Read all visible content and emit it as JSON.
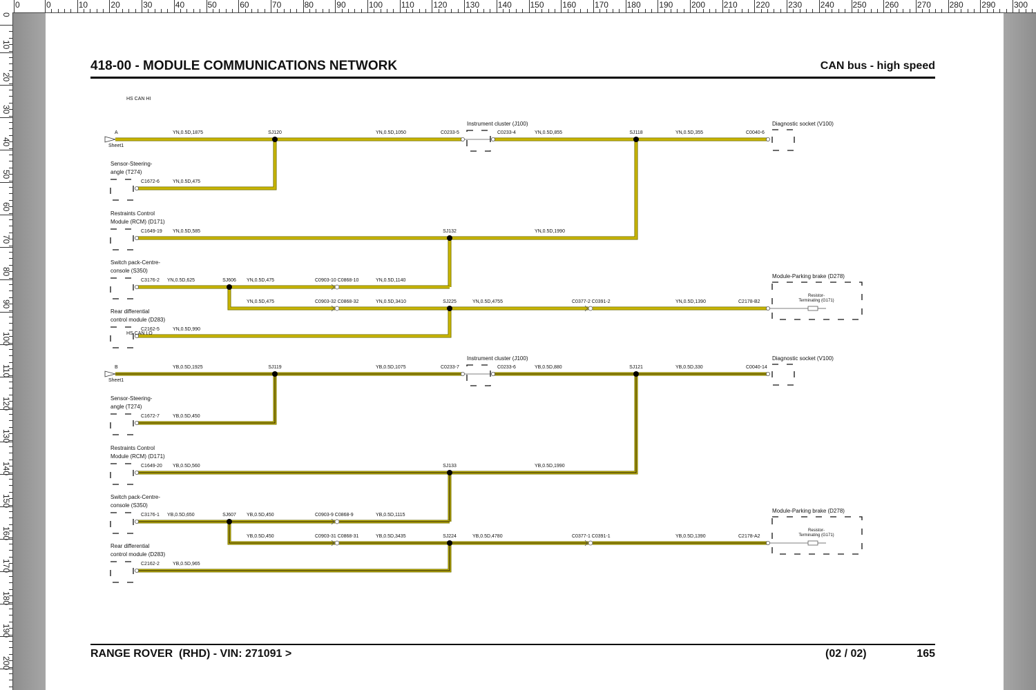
{
  "ruler": {
    "top_labels": [
      "0",
      "0",
      "10",
      "20",
      "30",
      "40",
      "50",
      "60",
      "70",
      "80",
      "90",
      "100",
      "110",
      "120",
      "130",
      "140",
      "150",
      "160",
      "170",
      "180",
      "190",
      "200",
      "210",
      "220",
      "230",
      "240",
      "250",
      "260",
      "270",
      "280",
      "290",
      "300"
    ],
    "left_labels": [
      "0",
      "10",
      "20",
      "30",
      "40",
      "50",
      "60",
      "70",
      "80",
      "90",
      "100",
      "110",
      "120",
      "130",
      "140",
      "150",
      "160",
      "170",
      "180",
      "190",
      "200"
    ]
  },
  "header": {
    "title": "418-00 - MODULE COMMUNICATIONS NETWORK",
    "subtitle": "CAN bus - high speed"
  },
  "footer": {
    "vehicle": "RANGE ROVER  (RHD) - VIN: 271091 >",
    "page_of": "(02 / 02)",
    "page_number": "165"
  },
  "colors": {
    "hi_wire": "#c8b400",
    "lo_wire": "#c8b400",
    "lo_core": "#1a1a1a",
    "outline": "#6b6b00"
  },
  "diagram": {
    "hi": {
      "net_label": "HS CAN HI",
      "offpage_letter": "A",
      "offpage_sheet": "Sheet1",
      "cluster_name": "Instrument cluster (J100)",
      "diag_name": "Diagnostic socket (V100)",
      "park_name": "Module-Parking brake (D278)",
      "resistor_label1": "Resistor-",
      "resistor_label2": "Terminating (G171)",
      "ssa_name1": "Sensor-Steering-",
      "ssa_name2": "angle (T274)",
      "rcm_name1": "Restraints Control",
      "rcm_name2": "Module (RCM) (D171)",
      "sw_name1": "Switch pack-Centre-",
      "sw_name2": "console (S350)",
      "rd_name1": "Rear differential",
      "rd_name2": "control module (D283)",
      "splices": [
        "SJ120",
        "SJ118",
        "SJ132",
        "SJ606",
        "SJ225"
      ],
      "connectors": [
        "C0233-5",
        "C0233-4",
        "C0040-6",
        "C1672-6",
        "C1649-19",
        "C3176-2",
        "C0903-10 C0868-10",
        "C0903-32 C0868-32",
        "C0377-2 C0391-2",
        "C2178-B2",
        "C2162-5"
      ],
      "wires": [
        "YN,0.5D,1875",
        "YN,0.5D,1050",
        "YN,0.5D,855",
        "YN,0.5D,355",
        "YN,0.5D,475",
        "YN,0.5D,585",
        "YN,0.5D,1990",
        "YN,0.5D,625",
        "YN,0.5D,475",
        "YN,0.5D,1140",
        "YN,0.5D,475",
        "YN,0.5D,3410",
        "YN,0.5D,4755",
        "YN,0.5D,1390",
        "YN,0.5D,990"
      ]
    },
    "lo": {
      "net_label": "HS CAN LO",
      "offpage_letter": "B",
      "offpage_sheet": "Sheet1",
      "cluster_name": "Instrument cluster (J100)",
      "diag_name": "Diagnostic socket (V100)",
      "park_name": "Module-Parking brake (D278)",
      "resistor_label1": "Resistor-",
      "resistor_label2": "Terminating (G171)",
      "ssa_name1": "Sensor-Steering-",
      "ssa_name2": "angle (T274)",
      "rcm_name1": "Restraints Control",
      "rcm_name2": "Module (RCM) (D171)",
      "sw_name1": "Switch pack-Centre-",
      "sw_name2": "console (S350)",
      "rd_name1": "Rear differential",
      "rd_name2": "control module (D283)",
      "splices": [
        "SJ119",
        "SJ121",
        "SJ133",
        "SJ607",
        "SJ224"
      ],
      "connectors": [
        "C0233-7",
        "C0233-6",
        "C0040-14",
        "C1672-7",
        "C1649-20",
        "C3176-1",
        "C0903-9 C0868-9",
        "C0903-31 C0868-31",
        "C0377-1 C0391-1",
        "C2178-A2",
        "C2162-2"
      ],
      "wires": [
        "YB,0.5D,1925",
        "YB,0.5D,1075",
        "YB,0.5D,880",
        "YB,0.5D,330",
        "YB,0.5D,450",
        "YB,0.5D,560",
        "YB,0.5D,1990",
        "YB,0.5D,650",
        "YB,0.5D,450",
        "YB,0.5D,1115",
        "YB,0.5D,450",
        "YB,0.5D,3435",
        "YB,0.5D,4780",
        "YB,0.5D,1390",
        "YB,0.5D,965"
      ]
    }
  }
}
